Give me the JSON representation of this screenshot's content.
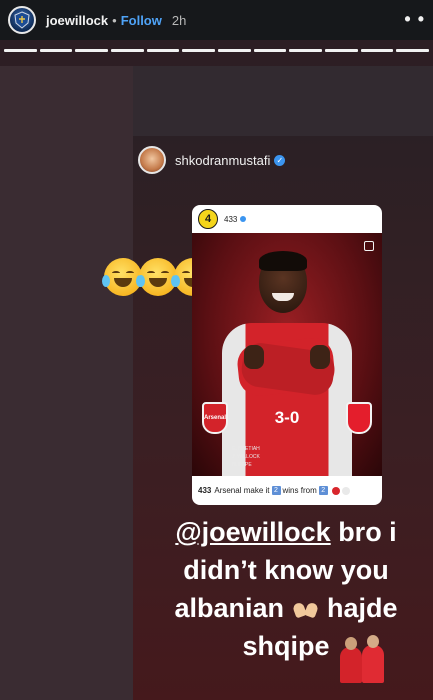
{
  "header": {
    "username": "joewillock",
    "follow_label": "Follow",
    "time": "2h"
  },
  "progress": {
    "segments": 12,
    "completed": 12
  },
  "embed": {
    "username": "shkodranmustafi",
    "card": {
      "account": "433",
      "logo": "4",
      "score": "3-0",
      "home_crest": "Arsenal",
      "scorers": [
        "E. NKETIAH",
        "J. WILLOCK",
        "N. PEPE"
      ],
      "caption_user": "433",
      "caption_text": "Arsenal make it",
      "caption_num": "2",
      "caption_mid": "wins from",
      "caption_num2": "2"
    }
  },
  "story": {
    "mention": "@joewillock",
    "line1_rest": " bro i",
    "line2": "didn’t know you",
    "line3a": "albanian",
    "line3b": "hajde",
    "line4": "shqipe"
  },
  "emojis": [
    "face-with-tears-of-joy",
    "face-with-tears-of-joy",
    "face-with-tears-of-joy",
    "face-with-tears-of-joy"
  ],
  "colors": {
    "accent_follow": "#4fa3f7",
    "verified": "#3b95f0",
    "arsenal_red": "#d3232a"
  }
}
